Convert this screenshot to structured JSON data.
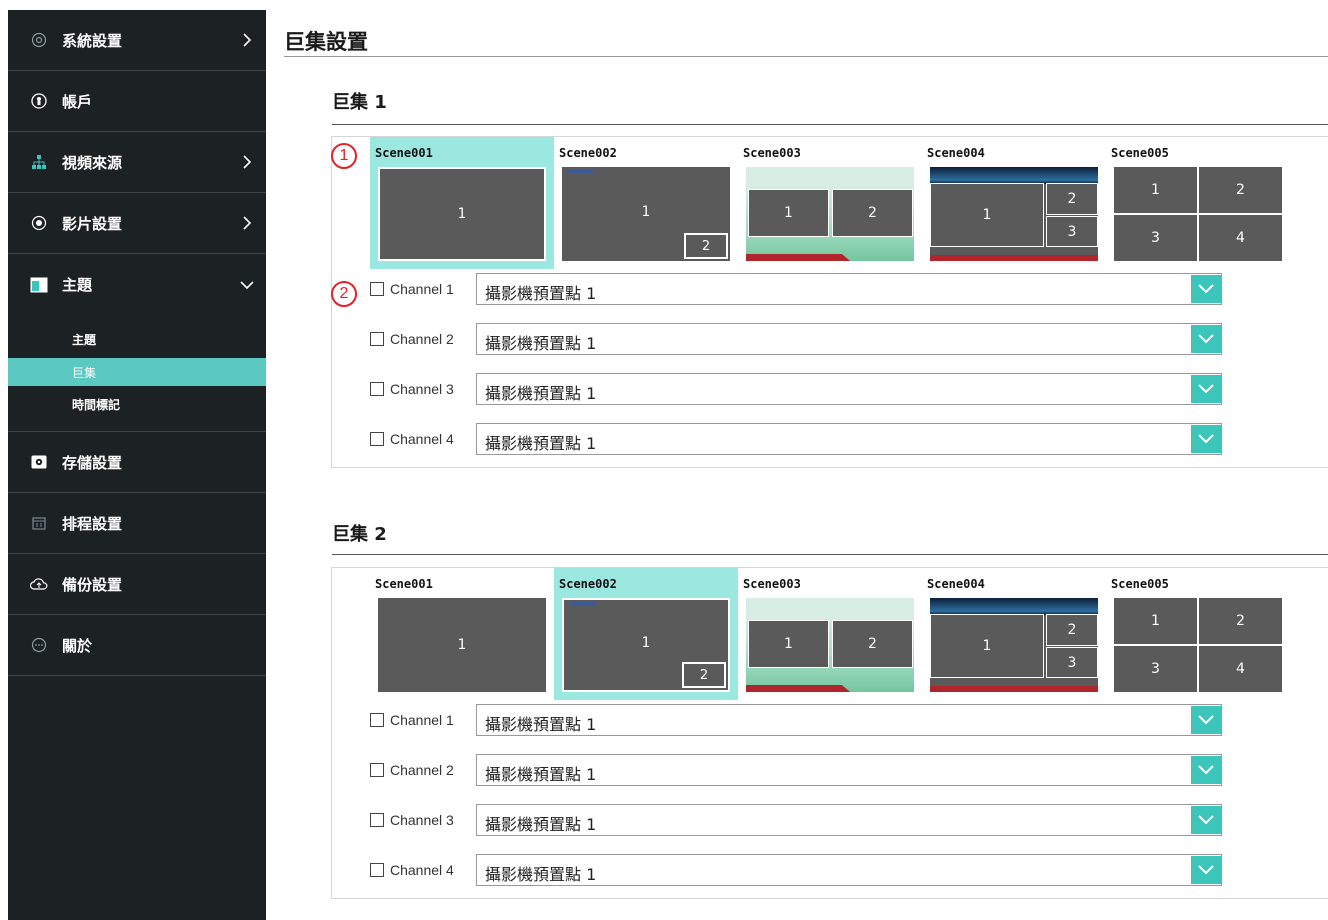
{
  "sidebar": {
    "items": [
      {
        "label": "系統設置",
        "icon": "gear-circle-icon",
        "arrow": "right"
      },
      {
        "label": "帳戶",
        "icon": "user-icon",
        "arrow": ""
      },
      {
        "label": "視頻來源",
        "icon": "network-icon",
        "arrow": "right"
      },
      {
        "label": "影片設置",
        "icon": "record-icon",
        "arrow": "right"
      },
      {
        "label": "主題",
        "icon": "layout-icon",
        "arrow": "down"
      },
      {
        "label": "存儲設置",
        "icon": "storage-icon",
        "arrow": ""
      },
      {
        "label": "排程設置",
        "icon": "calendar-icon",
        "arrow": ""
      },
      {
        "label": "備份設置",
        "icon": "cloud-upload-icon",
        "arrow": ""
      },
      {
        "label": "關於",
        "icon": "info-bubble-icon",
        "arrow": ""
      }
    ],
    "subitems": [
      {
        "label": "主題",
        "active": false
      },
      {
        "label": "巨集",
        "active": true
      },
      {
        "label": "時間標記",
        "active": false
      }
    ]
  },
  "page": {
    "title": "巨集設置"
  },
  "macros": [
    {
      "title": "巨集 1",
      "marker_scene": "1",
      "marker_channel": "2",
      "selected_scene": 1,
      "scenes": [
        "Scene001",
        "Scene002",
        "Scene003",
        "Scene004",
        "Scene005"
      ],
      "channels": [
        {
          "label": "Channel 1",
          "value": "攝影機預置點 1",
          "checked": false
        },
        {
          "label": "Channel 2",
          "value": "攝影機預置點 1",
          "checked": false
        },
        {
          "label": "Channel 3",
          "value": "攝影機預置點 1",
          "checked": false
        },
        {
          "label": "Channel 4",
          "value": "攝影機預置點 1",
          "checked": false
        }
      ]
    },
    {
      "title": "巨集 2",
      "selected_scene": 2,
      "scenes": [
        "Scene001",
        "Scene002",
        "Scene003",
        "Scene004",
        "Scene005"
      ],
      "channels": [
        {
          "label": "Channel 1",
          "value": "攝影機預置點 1",
          "checked": false
        },
        {
          "label": "Channel 2",
          "value": "攝影機預置點 1",
          "checked": false
        },
        {
          "label": "Channel 3",
          "value": "攝影機預置點 1",
          "checked": false
        },
        {
          "label": "Channel 4",
          "value": "攝影機預置點 1",
          "checked": false
        }
      ]
    }
  ],
  "thumb_labels": {
    "one": "1",
    "two": "2",
    "three": "3",
    "four": "4"
  },
  "colors": {
    "accent": "#5cc8c2",
    "selected_scene": "#9be8e0",
    "select_button": "#3cc5bb",
    "marker": "#e0232b",
    "sidebar_bg": "#1c2124"
  }
}
